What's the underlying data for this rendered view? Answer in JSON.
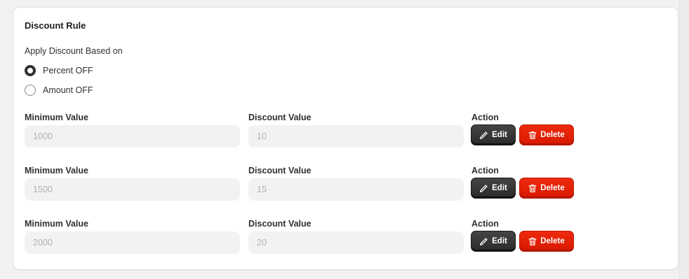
{
  "card": {
    "title": "Discount Rule",
    "apply_label": "Apply Discount Based on",
    "options": [
      {
        "label": "Percent OFF",
        "checked": true
      },
      {
        "label": "Amount OFF",
        "checked": false
      }
    ]
  },
  "columns": {
    "min": "Minimum Value",
    "discount": "Discount Value",
    "action": "Action"
  },
  "buttons": {
    "edit": "Edit",
    "delete": "Delete"
  },
  "rules": [
    {
      "min": "1000",
      "discount": "10"
    },
    {
      "min": "1500",
      "discount": "15"
    },
    {
      "min": "2000",
      "discount": "20"
    }
  ],
  "icons": {
    "edit": "pencil-icon",
    "delete": "trash-icon"
  },
  "colors": {
    "edit_bg": "#303030",
    "delete_bg": "#e51c00",
    "field_bg": "#f2f2f2"
  }
}
